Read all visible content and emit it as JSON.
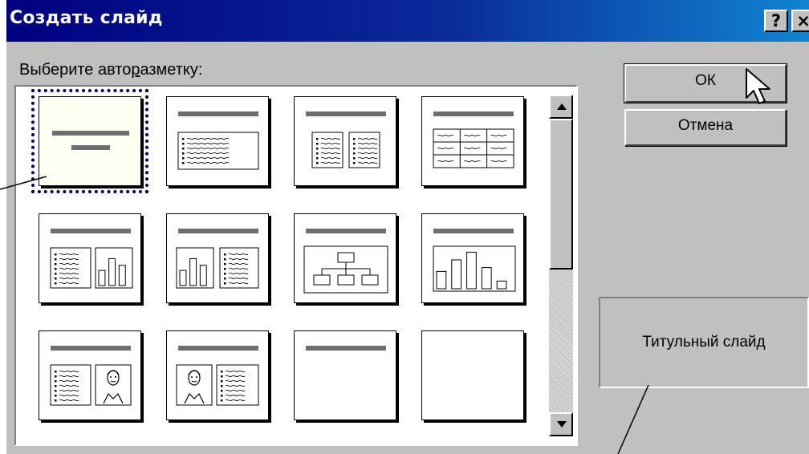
{
  "window": {
    "title": "Создать слайд",
    "help_label": "?",
    "close_label": "×"
  },
  "layout_picker": {
    "label_before": "Выберите авто",
    "label_mnemonic": "р",
    "label_after": "азметку:",
    "selected": "title-slide",
    "layouts": [
      {
        "id": "title-slide",
        "icon": "title-slide-icon"
      },
      {
        "id": "bulleted-list",
        "icon": "bulleted-list-icon"
      },
      {
        "id": "two-column-text",
        "icon": "two-column-text-icon"
      },
      {
        "id": "table",
        "icon": "table-icon"
      },
      {
        "id": "text-and-chart",
        "icon": "text-and-chart-icon"
      },
      {
        "id": "chart-and-text",
        "icon": "chart-and-text-icon"
      },
      {
        "id": "organization-chart",
        "icon": "organization-chart-icon"
      },
      {
        "id": "chart",
        "icon": "chart-icon"
      },
      {
        "id": "text-and-clip-art",
        "icon": "text-and-clip-art-icon"
      },
      {
        "id": "clip-art-and-text",
        "icon": "clip-art-and-text-icon"
      },
      {
        "id": "title-only",
        "icon": "title-only-icon"
      },
      {
        "id": "blank",
        "icon": "blank-icon"
      }
    ]
  },
  "buttons": {
    "ok_label": "ОК",
    "cancel_label": "Отмена"
  },
  "preview": {
    "layout_name": "Титульный слайд"
  },
  "colors": {
    "titlebar_start": "#000080",
    "titlebar_end": "#1084d0",
    "dialog_face": "#c0c0c0",
    "selection_outline": "#00005a"
  }
}
